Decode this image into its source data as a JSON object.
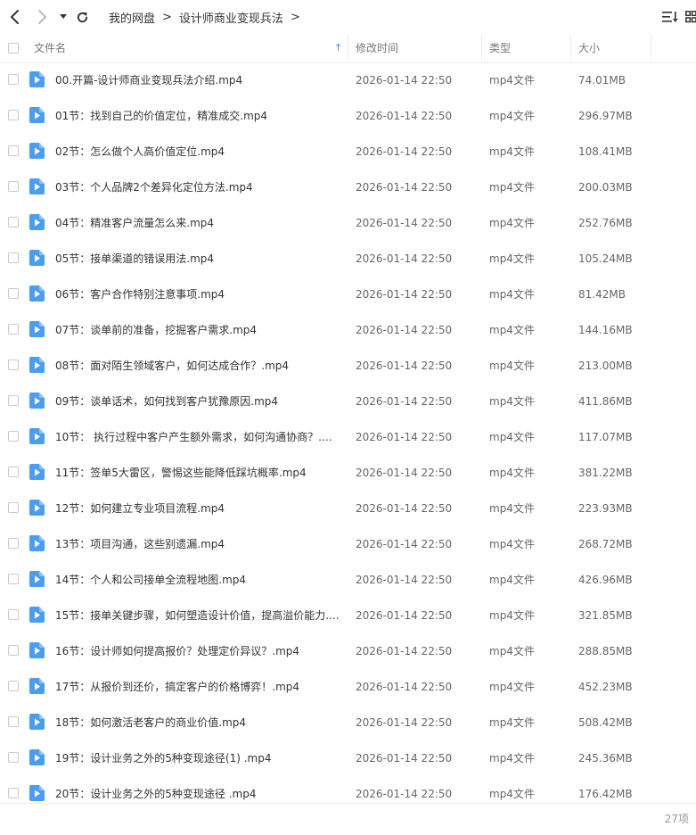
{
  "nav": {
    "back_icon": "chevron-left-icon",
    "forward_icon": "chevron-right-icon",
    "history_icon": "caret-down-icon",
    "refresh_icon": "refresh-icon"
  },
  "breadcrumb": {
    "items": [
      "我的网盘",
      "设计师商业变现兵法"
    ],
    "separator": ">"
  },
  "toolbar": {
    "sort_icon": "sort-list-icon",
    "view_icon": "grid-view-icon"
  },
  "columns": {
    "name": "文件名",
    "sort_indicator": "↑",
    "modified": "修改时间",
    "type": "类型",
    "size": "大小"
  },
  "files": [
    {
      "name": "00.开篇-设计师商业变现兵法介绍.mp4",
      "modified": "2026-01-14 22:50",
      "type": "mp4文件",
      "size": "74.01MB"
    },
    {
      "name": "01节：找到自己的价值定位，精准成交.mp4",
      "modified": "2026-01-14 22:50",
      "type": "mp4文件",
      "size": "296.97MB"
    },
    {
      "name": "02节：怎么做个人高价值定位.mp4",
      "modified": "2026-01-14 22:50",
      "type": "mp4文件",
      "size": "108.41MB"
    },
    {
      "name": "03节：个人品牌2个差异化定位方法.mp4",
      "modified": "2026-01-14 22:50",
      "type": "mp4文件",
      "size": "200.03MB"
    },
    {
      "name": "04节：精准客户流量怎么来.mp4",
      "modified": "2026-01-14 22:50",
      "type": "mp4文件",
      "size": "252.76MB"
    },
    {
      "name": "05节：接单渠道的错误用法.mp4",
      "modified": "2026-01-14 22:50",
      "type": "mp4文件",
      "size": "105.24MB"
    },
    {
      "name": "06节：客户合作特别注意事项.mp4",
      "modified": "2026-01-14 22:50",
      "type": "mp4文件",
      "size": "81.42MB"
    },
    {
      "name": "07节：谈单前的准备，挖掘客户需求.mp4",
      "modified": "2026-01-14 22:50",
      "type": "mp4文件",
      "size": "144.16MB"
    },
    {
      "name": "08节：面对陌生领域客户，如何达成合作？.mp4",
      "modified": "2026-01-14 22:50",
      "type": "mp4文件",
      "size": "213.00MB"
    },
    {
      "name": "09节：谈单话术，如何找到客户犹豫原因.mp4",
      "modified": "2026-01-14 22:50",
      "type": "mp4文件",
      "size": "411.86MB"
    },
    {
      "name": "10节： 执行过程中客户产生额外需求，如何沟通协商？.m...",
      "modified": "2026-01-14 22:50",
      "type": "mp4文件",
      "size": "117.07MB"
    },
    {
      "name": "11节：签单5大雷区，警惕这些能降低踩坑概率.mp4",
      "modified": "2026-01-14 22:50",
      "type": "mp4文件",
      "size": "381.22MB"
    },
    {
      "name": "12节：如何建立专业项目流程.mp4",
      "modified": "2026-01-14 22:50",
      "type": "mp4文件",
      "size": "223.93MB"
    },
    {
      "name": "13节：项目沟通，这些别遗漏.mp4",
      "modified": "2026-01-14 22:50",
      "type": "mp4文件",
      "size": "268.72MB"
    },
    {
      "name": "14节：个人和公司接单全流程地图.mp4",
      "modified": "2026-01-14 22:50",
      "type": "mp4文件",
      "size": "426.96MB"
    },
    {
      "name": "15节：接单关键步骤，如何塑造设计价值，提高溢价能力....",
      "modified": "2026-01-14 22:50",
      "type": "mp4文件",
      "size": "321.85MB"
    },
    {
      "name": "16节：设计师如何提高报价？处理定价异议？.mp4",
      "modified": "2026-01-14 22:50",
      "type": "mp4文件",
      "size": "288.85MB"
    },
    {
      "name": "17节：从报价到还价，搞定客户的价格博弈！.mp4",
      "modified": "2026-01-14 22:50",
      "type": "mp4文件",
      "size": "452.23MB"
    },
    {
      "name": "18节：如何激活老客户的商业价值.mp4",
      "modified": "2026-01-14 22:50",
      "type": "mp4文件",
      "size": "508.42MB"
    },
    {
      "name": "19节：设计业务之外的5种变现途径(1) .mp4",
      "modified": "2026-01-14 22:50",
      "type": "mp4文件",
      "size": "245.36MB"
    },
    {
      "name": "20节：设计业务之外的5种变现途径 .mp4",
      "modified": "2026-01-14 22:50",
      "type": "mp4文件",
      "size": "176.42MB"
    }
  ],
  "file_icon": "video-file-icon",
  "footer": {
    "count": "27项"
  },
  "colors": {
    "accent": "#3b8cf5",
    "icon_blue": "#4a9ef2",
    "border": "#ebebeb"
  }
}
